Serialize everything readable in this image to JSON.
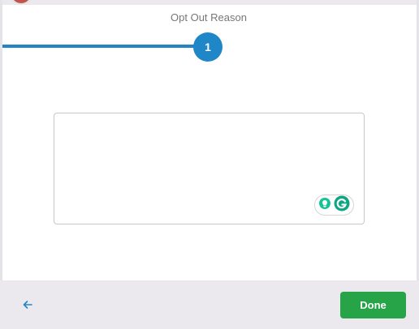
{
  "stepper": {
    "title": "Opt Out Reason",
    "current_step": "1"
  },
  "reason_input": {
    "value": "",
    "placeholder": ""
  },
  "grammarly": {
    "icons": [
      "lightbulb-icon",
      "grammarly-logo-icon"
    ]
  },
  "footer": {
    "back_icon": "arrow-left-icon",
    "done_label": "Done"
  },
  "colors": {
    "accent_blue": "#1f86c8",
    "done_green": "#27a447",
    "grammarly_green": "#15c39a"
  }
}
